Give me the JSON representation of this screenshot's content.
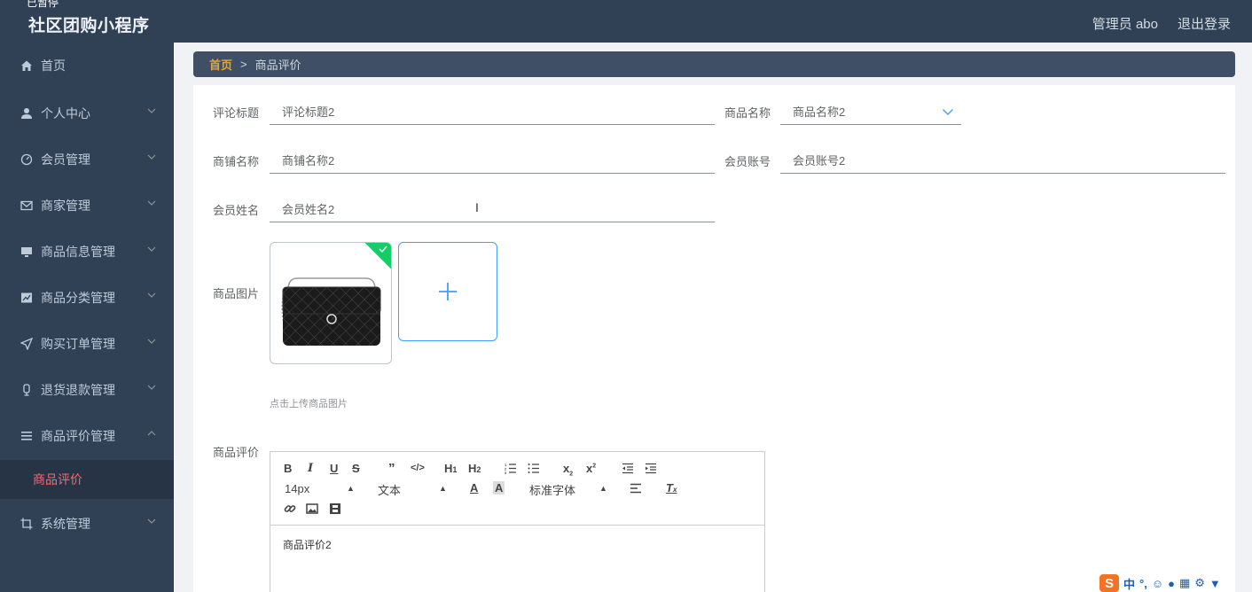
{
  "header": {
    "paused_label": "已暂停",
    "app_title": "社区团购小程序",
    "admin_label": "管理员 abo",
    "logout_label": "退出登录"
  },
  "sidebar": {
    "items": [
      {
        "label": "首页",
        "icon": "home-icon"
      },
      {
        "label": "个人中心",
        "icon": "user-icon"
      },
      {
        "label": "会员管理",
        "icon": "member-icon"
      },
      {
        "label": "商家管理",
        "icon": "mail-icon"
      },
      {
        "label": "商品信息管理",
        "icon": "monitor-icon"
      },
      {
        "label": "商品分类管理",
        "icon": "chart-icon"
      },
      {
        "label": "购买订单管理",
        "icon": "send-icon"
      },
      {
        "label": "退货退款管理",
        "icon": "refund-icon"
      },
      {
        "label": "商品评价管理",
        "icon": "list-icon"
      },
      {
        "label": "系统管理",
        "icon": "crop-icon"
      }
    ],
    "active_sub": "商品评价"
  },
  "breadcrumb": {
    "home": "首页",
    "separator": ">",
    "current": "商品评价"
  },
  "form": {
    "comment_title_label": "评论标题",
    "comment_title_value": "评论标题2",
    "product_name_label": "商品名称",
    "product_name_value": "商品名称2",
    "shop_name_label": "商铺名称",
    "shop_name_value": "商铺名称2",
    "member_account_label": "会员账号",
    "member_account_value": "会员账号2",
    "member_name_label": "会员姓名",
    "member_name_value": "会员姓名2",
    "product_image_label": "商品图片",
    "upload_hint": "点击上传商品图片",
    "review_label": "商品评价"
  },
  "editor": {
    "font_size": "14px",
    "text_style": "文本",
    "font_family": "标准字体",
    "content": "商品评价2"
  },
  "ime": {
    "logo": "S",
    "mode": "中"
  },
  "colors": {
    "sidebar_bg": "#304156",
    "accent_orange": "#e6a23c",
    "active_red": "#f56c6c",
    "upload_blue": "#409eff",
    "success_green": "#13ce66"
  }
}
